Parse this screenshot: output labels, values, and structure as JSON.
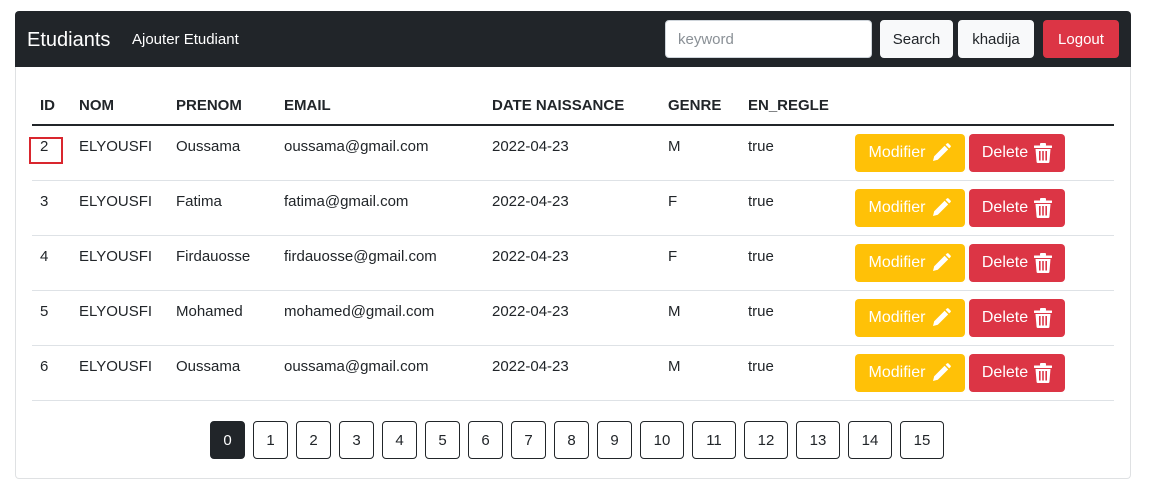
{
  "navbar": {
    "brand": "Etudiants",
    "link": "Ajouter Etudiant",
    "search_placeholder": "keyword",
    "search_button": "Search",
    "user_button": "khadija",
    "logout_button": "Logout"
  },
  "table": {
    "headers": [
      "ID",
      "NOM",
      "PRENOM",
      "EMAIL",
      "DATE NAISSANCE",
      "GENRE",
      "EN_REGLE"
    ],
    "rows": [
      {
        "id": "2",
        "nom": "ELYOUSFI",
        "prenom": "Oussama",
        "email": "oussama@gmail.com",
        "date": "2022-04-23",
        "genre": "M",
        "en_regle": "true"
      },
      {
        "id": "3",
        "nom": "ELYOUSFI",
        "prenom": "Fatima",
        "email": "fatima@gmail.com",
        "date": "2022-04-23",
        "genre": "F",
        "en_regle": "true"
      },
      {
        "id": "4",
        "nom": "ELYOUSFI",
        "prenom": "Firdauosse",
        "email": "firdauosse@gmail.com",
        "date": "2022-04-23",
        "genre": "F",
        "en_regle": "true"
      },
      {
        "id": "5",
        "nom": "ELYOUSFI",
        "prenom": "Mohamed",
        "email": "mohamed@gmail.com",
        "date": "2022-04-23",
        "genre": "M",
        "en_regle": "true"
      },
      {
        "id": "6",
        "nom": "ELYOUSFI",
        "prenom": "Oussama",
        "email": "oussama@gmail.com",
        "date": "2022-04-23",
        "genre": "M",
        "en_regle": "true"
      }
    ],
    "edit_label": "Modifier",
    "delete_label": "Delete"
  },
  "pagination": {
    "pages": [
      "0",
      "1",
      "2",
      "3",
      "4",
      "5",
      "6",
      "7",
      "8",
      "9",
      "10",
      "11",
      "12",
      "13",
      "14",
      "15"
    ],
    "active": "0"
  },
  "colors": {
    "navbar": "#212529",
    "warning": "#ffc107",
    "danger": "#dc3545",
    "highlight": "#d9262e"
  },
  "icons": {
    "edit": "pencil-icon",
    "delete": "trash-icon"
  }
}
